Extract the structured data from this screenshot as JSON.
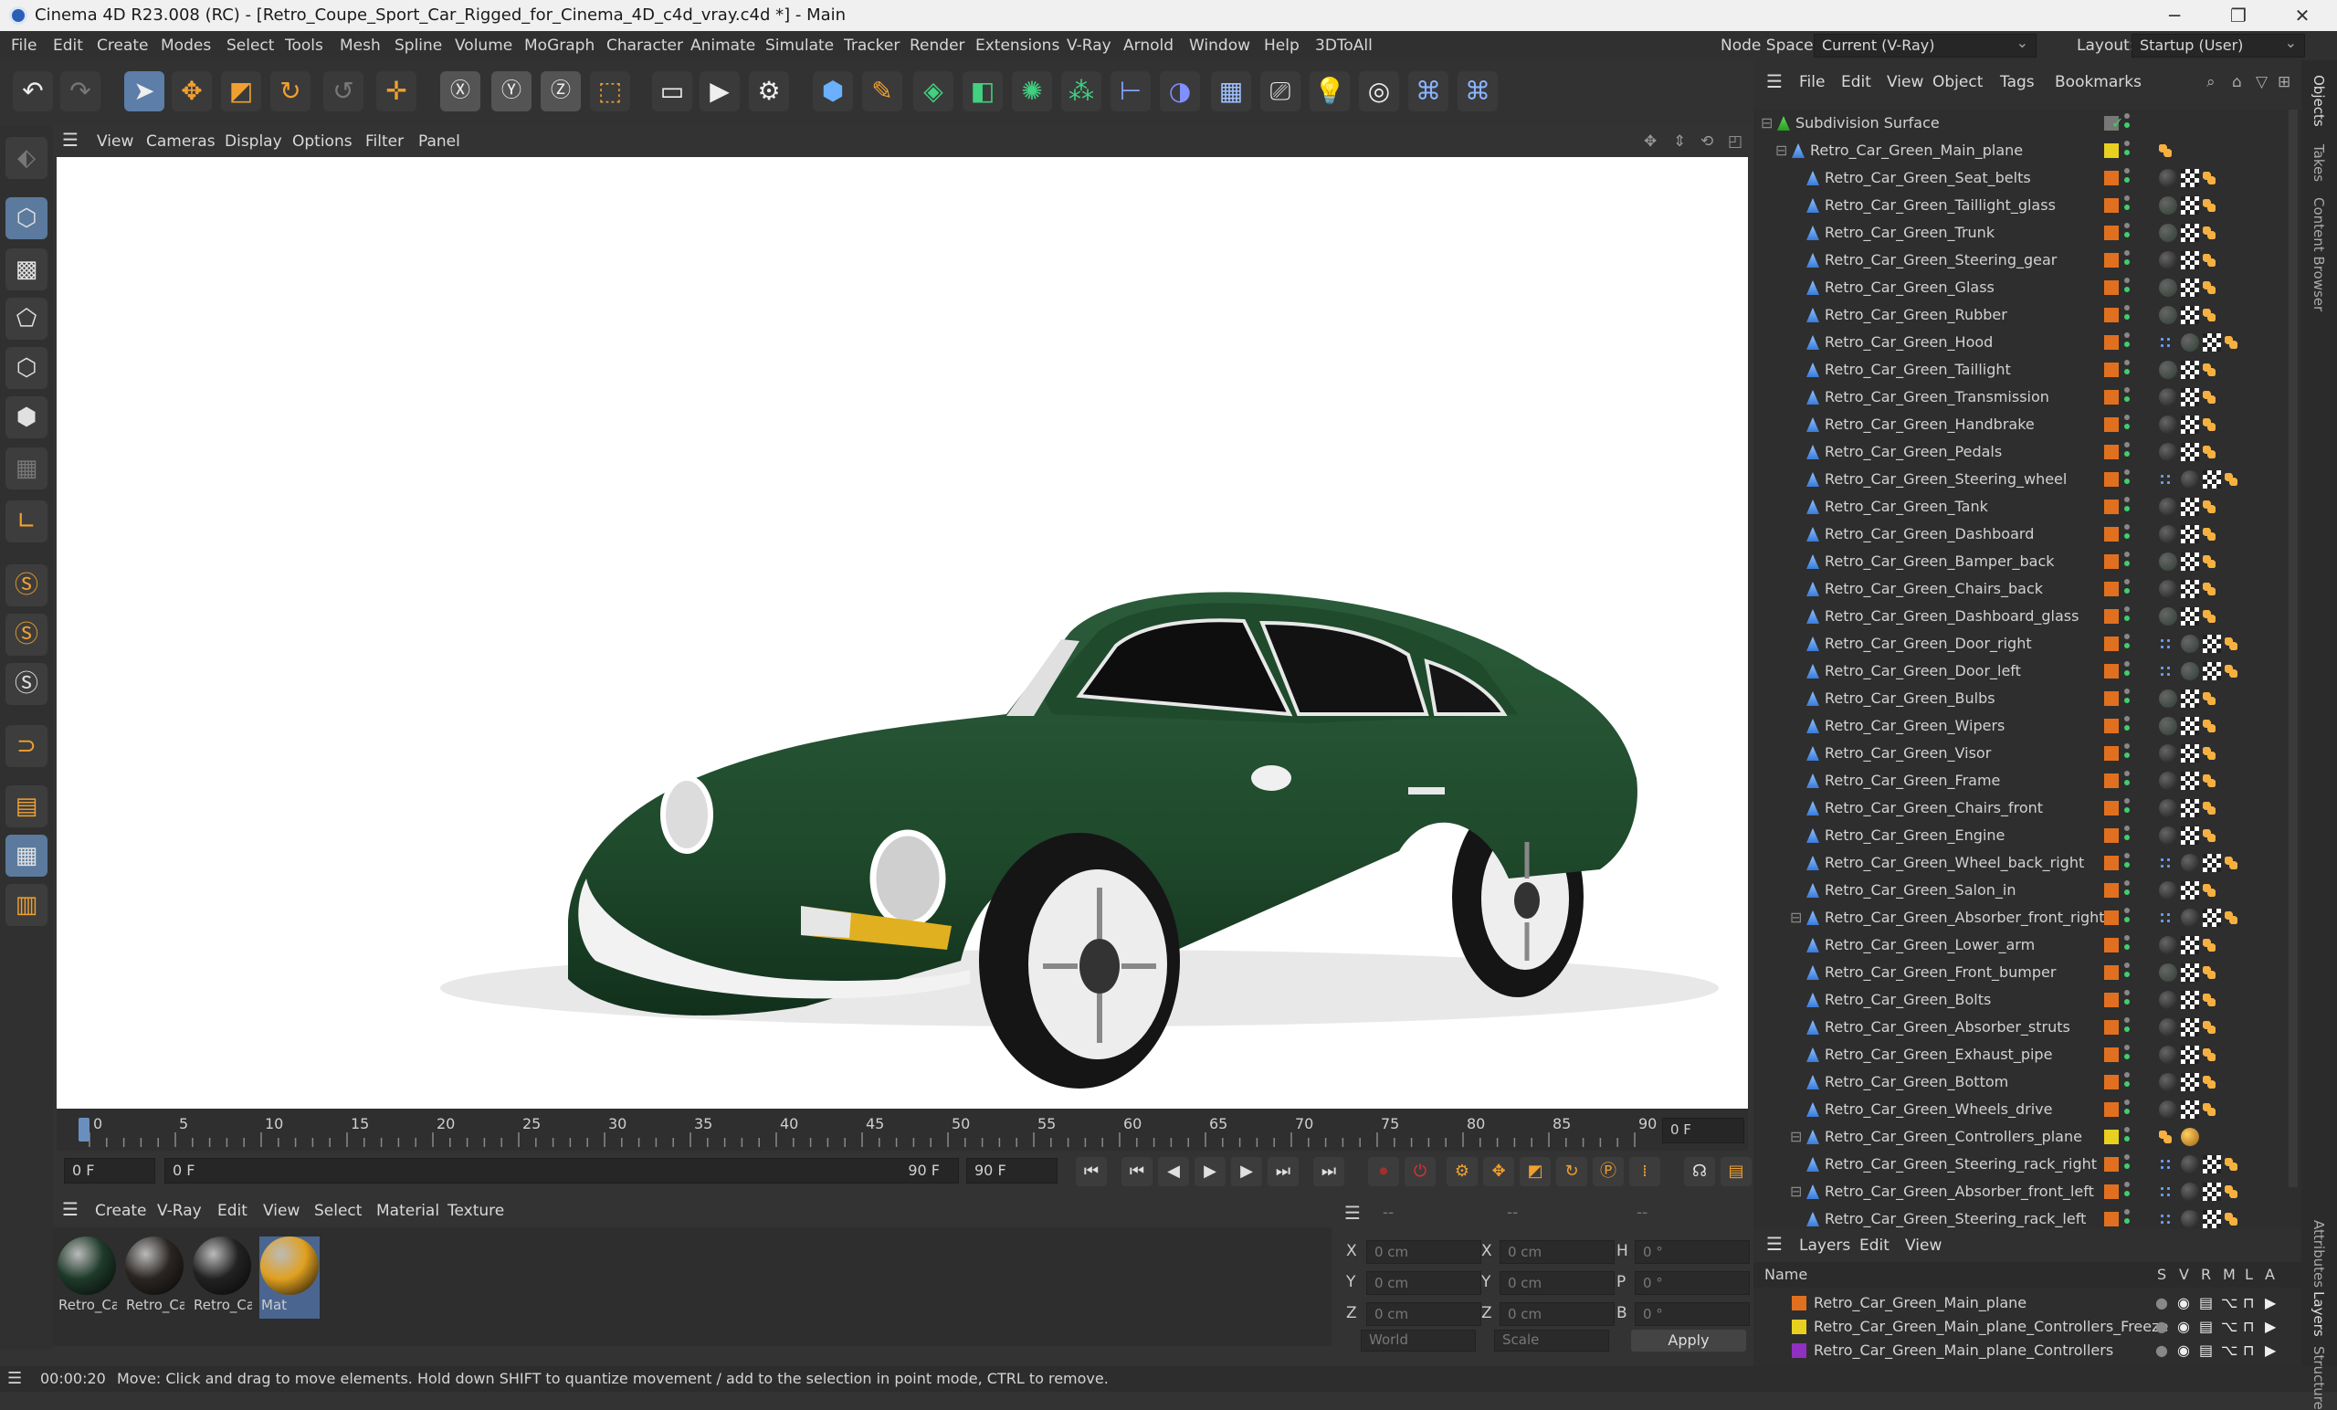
{
  "window": {
    "title": "Cinema 4D R23.008 (RC) - [Retro_Coupe_Sport_Car_Rigged_for_Cinema_4D_c4d_vray.c4d *] - Main",
    "minimize": "─",
    "maximize": "❐",
    "close": "✕"
  },
  "menubar": {
    "items": [
      "File",
      "Edit",
      "Create",
      "Modes",
      "Select",
      "Tools",
      "Mesh",
      "Spline",
      "Volume",
      "MoGraph",
      "Character",
      "Animate",
      "Simulate",
      "Tracker",
      "Render",
      "Extensions",
      "V-Ray",
      "Arnold",
      "Window",
      "Help",
      "3DToAll"
    ],
    "node_space_label": "Node Space:",
    "node_space_value": "Current (V-Ray)",
    "layout_label": "Layout:",
    "layout_value": "Startup (User)"
  },
  "viewport_menu": [
    "View",
    "Cameras",
    "Display",
    "Options",
    "Filter",
    "Panel"
  ],
  "timeline": {
    "ticks": [
      "0",
      "5",
      "10",
      "15",
      "20",
      "25",
      "30",
      "35",
      "40",
      "45",
      "50",
      "55",
      "60",
      "65",
      "70",
      "75",
      "80",
      "85",
      "90"
    ],
    "current_frame": "0 F"
  },
  "transport": {
    "start": "0 F",
    "range_start": "0 F",
    "range_end": "90 F",
    "end": "90 F"
  },
  "material_menu": [
    "Create",
    "V-Ray",
    "Edit",
    "View",
    "Select",
    "Material",
    "Texture"
  ],
  "materials": [
    {
      "label": "Retro_Ca",
      "color": "#1e3a2a"
    },
    {
      "label": "Retro_Ca",
      "color": "#2a2522"
    },
    {
      "label": "Retro_Ca",
      "color": "#222"
    },
    {
      "label": "Mat",
      "color": "#e0a020"
    }
  ],
  "coordinates": {
    "x_pos": "0 cm",
    "y_pos": "0 cm",
    "z_pos": "0 cm",
    "x_size": "0 cm",
    "y_size": "0 cm",
    "z_size": "0 cm",
    "h": "0 °",
    "p": "0 °",
    "b": "0 °",
    "mode": "World",
    "size_mode": "Scale",
    "apply": "Apply",
    "top_dash_1": "--",
    "top_dash_2": "--",
    "top_dash_3": "--"
  },
  "status": {
    "time": "00:00:20",
    "message": "Move: Click and drag to move elements. Hold down SHIFT to quantize movement / add to the selection in point mode, CTRL to remove."
  },
  "object_menu": [
    "File",
    "Edit",
    "View",
    "Object",
    "Tags",
    "Bookmarks"
  ],
  "objects": [
    {
      "name": "Subdivision Surface",
      "indent": 0,
      "swatch": "#777",
      "type": "sds",
      "tags": []
    },
    {
      "name": "Retro_Car_Green_Main_plane",
      "indent": 1,
      "swatch": "#e8d020",
      "type": "poly",
      "tags": [
        "o"
      ]
    },
    {
      "name": "Retro_Car_Green_Seat_belts",
      "indent": 2,
      "swatch": "#e07020",
      "type": "poly",
      "tags": [
        "b",
        "c",
        "o"
      ]
    },
    {
      "name": "Retro_Car_Green_Taillight_glass",
      "indent": 2,
      "swatch": "#e07020",
      "type": "poly",
      "tags": [
        "g",
        "c",
        "o"
      ]
    },
    {
      "name": "Retro_Car_Green_Trunk",
      "indent": 2,
      "swatch": "#e07020",
      "type": "poly",
      "tags": [
        "g",
        "c",
        "o"
      ]
    },
    {
      "name": "Retro_Car_Green_Steering_gear",
      "indent": 2,
      "swatch": "#e07020",
      "type": "poly",
      "tags": [
        "b",
        "c",
        "o"
      ]
    },
    {
      "name": "Retro_Car_Green_Glass",
      "indent": 2,
      "swatch": "#e07020",
      "type": "poly",
      "tags": [
        "g",
        "c",
        "o"
      ]
    },
    {
      "name": "Retro_Car_Green_Rubber",
      "indent": 2,
      "swatch": "#e07020",
      "type": "poly",
      "tags": [
        "g",
        "c",
        "o"
      ]
    },
    {
      "name": "Retro_Car_Green_Hood",
      "indent": 2,
      "swatch": "#e07020",
      "type": "poly",
      "tags": [
        "d",
        "g",
        "c",
        "o"
      ]
    },
    {
      "name": "Retro_Car_Green_Taillight",
      "indent": 2,
      "swatch": "#e07020",
      "type": "poly",
      "tags": [
        "g",
        "c",
        "o"
      ]
    },
    {
      "name": "Retro_Car_Green_Transmission",
      "indent": 2,
      "swatch": "#e07020",
      "type": "poly",
      "tags": [
        "b",
        "c",
        "o"
      ]
    },
    {
      "name": "Retro_Car_Green_Handbrake",
      "indent": 2,
      "swatch": "#e07020",
      "type": "poly",
      "tags": [
        "b",
        "c",
        "o"
      ]
    },
    {
      "name": "Retro_Car_Green_Pedals",
      "indent": 2,
      "swatch": "#e07020",
      "type": "poly",
      "tags": [
        "b",
        "c",
        "o"
      ]
    },
    {
      "name": "Retro_Car_Green_Steering_wheel",
      "indent": 2,
      "swatch": "#e07020",
      "type": "poly",
      "tags": [
        "d",
        "b",
        "c",
        "o"
      ]
    },
    {
      "name": "Retro_Car_Green_Tank",
      "indent": 2,
      "swatch": "#e07020",
      "type": "poly",
      "tags": [
        "b",
        "c",
        "o"
      ]
    },
    {
      "name": "Retro_Car_Green_Dashboard",
      "indent": 2,
      "swatch": "#e07020",
      "type": "poly",
      "tags": [
        "b",
        "c",
        "o"
      ]
    },
    {
      "name": "Retro_Car_Green_Bamper_back",
      "indent": 2,
      "swatch": "#e07020",
      "type": "poly",
      "tags": [
        "g",
        "c",
        "o"
      ]
    },
    {
      "name": "Retro_Car_Green_Chairs_back",
      "indent": 2,
      "swatch": "#e07020",
      "type": "poly",
      "tags": [
        "b",
        "c",
        "o"
      ]
    },
    {
      "name": "Retro_Car_Green_Dashboard_glass",
      "indent": 2,
      "swatch": "#e07020",
      "type": "poly",
      "tags": [
        "g",
        "c",
        "o"
      ]
    },
    {
      "name": "Retro_Car_Green_Door_right",
      "indent": 2,
      "swatch": "#e07020",
      "type": "poly",
      "tags": [
        "d",
        "g",
        "c",
        "o"
      ]
    },
    {
      "name": "Retro_Car_Green_Door_left",
      "indent": 2,
      "swatch": "#e07020",
      "type": "poly",
      "tags": [
        "d",
        "g",
        "c",
        "o"
      ]
    },
    {
      "name": "Retro_Car_Green_Bulbs",
      "indent": 2,
      "swatch": "#e07020",
      "type": "poly",
      "tags": [
        "g",
        "c",
        "o"
      ]
    },
    {
      "name": "Retro_Car_Green_Wipers",
      "indent": 2,
      "swatch": "#e07020",
      "type": "poly",
      "tags": [
        "g",
        "c",
        "o"
      ]
    },
    {
      "name": "Retro_Car_Green_Visor",
      "indent": 2,
      "swatch": "#e07020",
      "type": "poly",
      "tags": [
        "b",
        "c",
        "o"
      ]
    },
    {
      "name": "Retro_Car_Green_Frame",
      "indent": 2,
      "swatch": "#e07020",
      "type": "poly",
      "tags": [
        "b",
        "c",
        "o"
      ]
    },
    {
      "name": "Retro_Car_Green_Chairs_front",
      "indent": 2,
      "swatch": "#e07020",
      "type": "poly",
      "tags": [
        "b",
        "c",
        "o"
      ]
    },
    {
      "name": "Retro_Car_Green_Engine",
      "indent": 2,
      "swatch": "#e07020",
      "type": "poly",
      "tags": [
        "b",
        "c",
        "o"
      ]
    },
    {
      "name": "Retro_Car_Green_Wheel_back_right",
      "indent": 2,
      "swatch": "#e07020",
      "type": "poly",
      "tags": [
        "d",
        "b",
        "c",
        "o"
      ]
    },
    {
      "name": "Retro_Car_Green_Salon_in",
      "indent": 2,
      "swatch": "#e07020",
      "type": "poly",
      "tags": [
        "b",
        "c",
        "o"
      ]
    },
    {
      "name": "Retro_Car_Green_Absorber_front_right",
      "indent": 2,
      "swatch": "#e07020",
      "type": "poly",
      "tags": [
        "d",
        "b",
        "c",
        "o"
      ],
      "expand": true
    },
    {
      "name": "Retro_Car_Green_Lower_arm",
      "indent": 2,
      "swatch": "#e07020",
      "type": "poly",
      "tags": [
        "b",
        "c",
        "o"
      ]
    },
    {
      "name": "Retro_Car_Green_Front_bumper",
      "indent": 2,
      "swatch": "#e07020",
      "type": "poly",
      "tags": [
        "g",
        "c",
        "o"
      ]
    },
    {
      "name": "Retro_Car_Green_Bolts",
      "indent": 2,
      "swatch": "#e07020",
      "type": "poly",
      "tags": [
        "b",
        "c",
        "o"
      ]
    },
    {
      "name": "Retro_Car_Green_Absorber_struts",
      "indent": 2,
      "swatch": "#e07020",
      "type": "poly",
      "tags": [
        "b",
        "c",
        "o"
      ]
    },
    {
      "name": "Retro_Car_Green_Exhaust_pipe",
      "indent": 2,
      "swatch": "#e07020",
      "type": "poly",
      "tags": [
        "b",
        "c",
        "o"
      ]
    },
    {
      "name": "Retro_Car_Green_Bottom",
      "indent": 2,
      "swatch": "#e07020",
      "type": "poly",
      "tags": [
        "b",
        "c",
        "o"
      ]
    },
    {
      "name": "Retro_Car_Green_Wheels_drive",
      "indent": 2,
      "swatch": "#e07020",
      "type": "poly",
      "tags": [
        "b",
        "c",
        "o"
      ]
    },
    {
      "name": "Retro_Car_Green_Controllers_plane",
      "indent": 2,
      "swatch": "#e8d020",
      "type": "poly",
      "tags": [
        "o",
        "y"
      ],
      "expand": true
    },
    {
      "name": "Retro_Car_Green_Steering_rack_right",
      "indent": 2,
      "swatch": "#e07020",
      "type": "poly",
      "tags": [
        "d",
        "b",
        "c",
        "o"
      ]
    },
    {
      "name": "Retro_Car_Green_Absorber_front_left",
      "indent": 2,
      "swatch": "#e07020",
      "type": "poly",
      "tags": [
        "d",
        "b",
        "c",
        "o"
      ],
      "expand": true
    },
    {
      "name": "Retro_Car_Green_Steering_rack_left",
      "indent": 2,
      "swatch": "#e07020",
      "type": "poly",
      "tags": [
        "d",
        "b",
        "c",
        "o"
      ]
    }
  ],
  "layers_menu": [
    "Layers",
    "Edit",
    "View"
  ],
  "layers_header": {
    "name": "Name",
    "cols": [
      "S",
      "V",
      "R",
      "M",
      "L",
      "A"
    ]
  },
  "layers": [
    {
      "name": "Retro_Car_Green_Main_plane",
      "color": "#e07020"
    },
    {
      "name": "Retro_Car_Green_Main_plane_Controllers_Freeze",
      "color": "#e8d020"
    },
    {
      "name": "Retro_Car_Green_Main_plane_Controllers",
      "color": "#9030c0"
    }
  ],
  "right_tabs": [
    "Objects",
    "Takes",
    "Content Browser",
    "Attributes",
    "Layers",
    "Structure"
  ],
  "colors": {
    "car_green": "#1f4a2c",
    "accent_blue": "#5c7ea8",
    "tag_orange": "#f0a030"
  }
}
